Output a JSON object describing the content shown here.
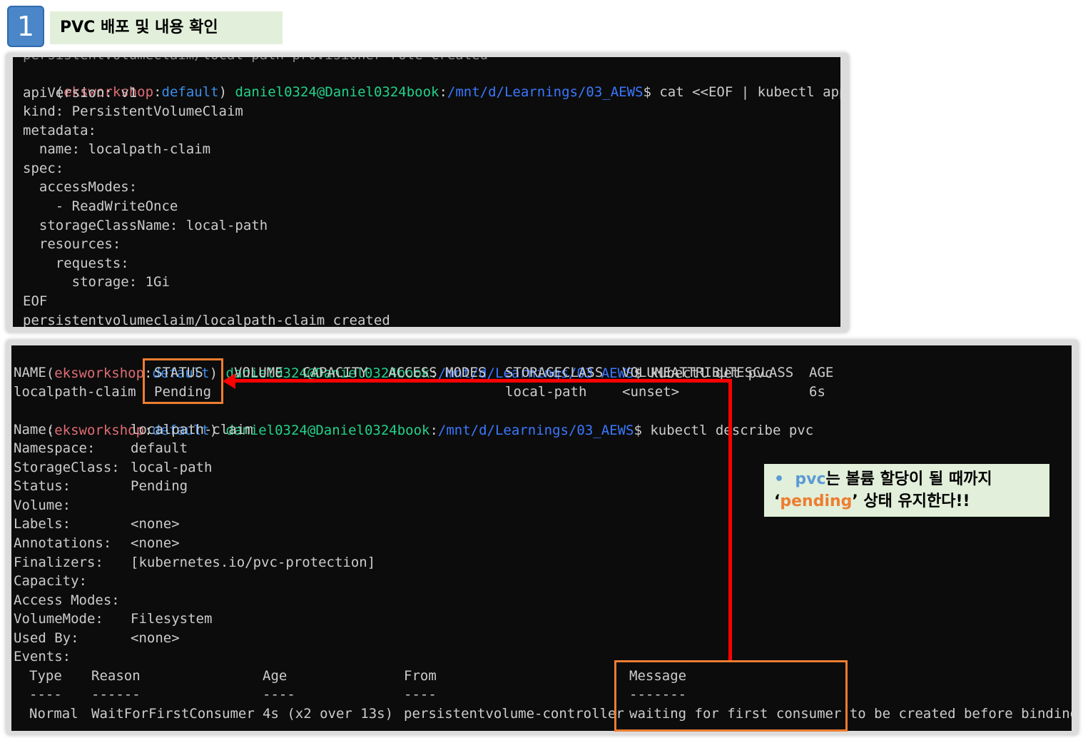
{
  "step": {
    "number": "1",
    "title": "PVC 배포 및 내용 확인"
  },
  "prompt": {
    "open": "(",
    "env": "eksworkshop",
    "colon": ":",
    "ns": "default",
    "close": ") ",
    "user": "daniel0324@Daniel0324book",
    "colon2": ":",
    "path": "/mnt/d/Learnings/03_AEWS",
    "dollar": "$"
  },
  "terminal1": {
    "cut_line": "persistentvolumeclaim/local-path-provisioner-role created",
    "command": " cat <<EOF | kubectl apply -f -",
    "lines": [
      "apiVersion: v1",
      "kind: PersistentVolumeClaim",
      "metadata:",
      "  name: localpath-claim",
      "spec:",
      "  accessModes:",
      "    - ReadWriteOnce",
      "  storageClassName: local-path",
      "  resources:",
      "    requests:",
      "      storage: 1Gi",
      "EOF",
      "persistentvolumeclaim/localpath-claim created"
    ]
  },
  "terminal2": {
    "cmd_get": " kubectl get pvc",
    "table_headers": [
      "NAME",
      "STATUS",
      "VOLUME",
      "CAPACITY",
      "ACCESS MODES",
      "STORAGECLASS",
      "VOLUMEATTRIBUTESCLASS",
      "AGE"
    ],
    "table_row": [
      "localpath-claim",
      "Pending",
      "",
      "",
      "",
      "local-path",
      "<unset>",
      "6s"
    ],
    "cmd_describe": " kubectl describe pvc",
    "describe": [
      {
        "key": "Name:",
        "value": "localpath-claim"
      },
      {
        "key": "Namespace:",
        "value": "default"
      },
      {
        "key": "StorageClass:",
        "value": "local-path"
      },
      {
        "key": "Status:",
        "value": "Pending"
      },
      {
        "key": "Volume:",
        "value": ""
      },
      {
        "key": "Labels:",
        "value": "<none>"
      },
      {
        "key": "Annotations:",
        "value": "<none>"
      },
      {
        "key": "Finalizers:",
        "value": "[kubernetes.io/pvc-protection]"
      },
      {
        "key": "Capacity:",
        "value": ""
      },
      {
        "key": "Access Modes:",
        "value": ""
      },
      {
        "key": "VolumeMode:",
        "value": "Filesystem"
      },
      {
        "key": "Used By:",
        "value": "<none>"
      },
      {
        "key": "Events:",
        "value": ""
      }
    ],
    "events_headers": [
      "Type",
      "Reason",
      "Age",
      "From",
      "Message"
    ],
    "events_dashes": [
      "----",
      "------",
      "----",
      "----",
      "-------"
    ],
    "events_row": [
      "Normal",
      "WaitForFirstConsumer",
      "4s (x2 over 13s)",
      "persistentvolume-controller",
      "waiting for first consumer to be created before binding"
    ]
  },
  "callout": {
    "bullet": "•",
    "pvc": "pvc",
    "line1_rest": "는 볼륨 할당이 될 때까지",
    "quote_open": "‘",
    "pending": "pending",
    "line2_rest": "’ 상태 유지한다!!"
  },
  "colors": {
    "highlight_box": "#ed7d31",
    "arrow": "#ff0000",
    "callout_bg": "#e2efda",
    "step_badge": "#4a86c8"
  }
}
